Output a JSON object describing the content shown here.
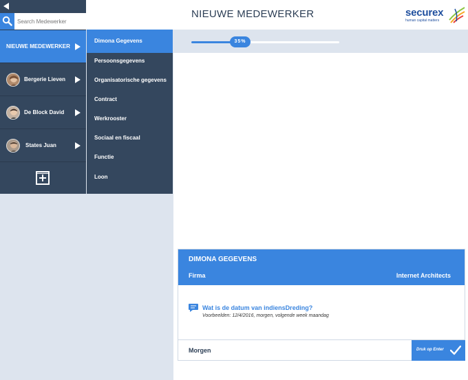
{
  "search": {
    "placeholder": "Search Medewerker"
  },
  "left_panel": {
    "new_employee_label": "NIEUWE MEDEWERKER",
    "employees": [
      {
        "name": "Bergerie Lieven"
      },
      {
        "name": "De Block David"
      },
      {
        "name": "States Juan"
      }
    ]
  },
  "header": {
    "title": "NIEUWE MEDEWERKER",
    "logo_text": "securex",
    "logo_tagline": "human capital matters"
  },
  "nav": {
    "items": [
      {
        "label": "Dimona Gegevens",
        "active": true
      },
      {
        "label": "Persoonsgegevens"
      },
      {
        "label": "Organisatorische gegevens"
      },
      {
        "label": "Contract"
      },
      {
        "label": "Werkrooster"
      },
      {
        "label": "Sociaal en fiscaal"
      },
      {
        "label": "Functie"
      },
      {
        "label": "Loon"
      }
    ]
  },
  "progress": {
    "label": "35%",
    "value": 0.35
  },
  "card": {
    "title": "DIMONA GEGEVENS",
    "firma_label": "Firma",
    "firma_value": "Internet Architects",
    "question": "Wat is de datum van indiensDreding?",
    "examples": "Voorbeelden: 12/4/2016, morgen, volgende week maandag",
    "answer_value": "Morgen",
    "enter_label": "Druk op Enter"
  },
  "colors": {
    "accent": "#3a85df",
    "dark_panel": "#34475e",
    "background": "#dde4ee"
  }
}
